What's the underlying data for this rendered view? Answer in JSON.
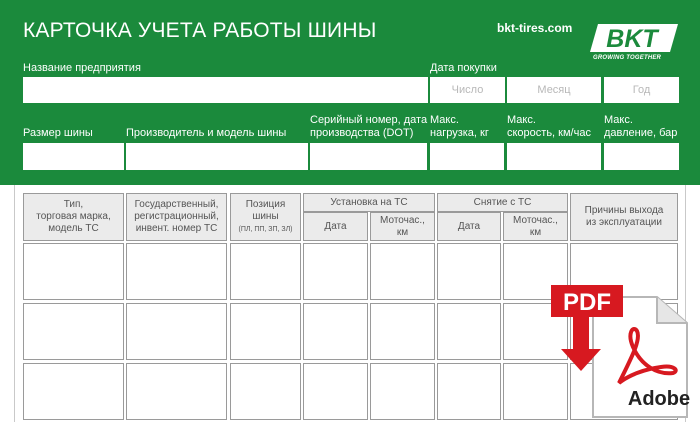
{
  "header": {
    "title": "КАРТОЧКА УЧЕТА РАБОТЫ ШИНЫ",
    "site": "bkt-tires.com",
    "logo_text": "BKT",
    "tagline": "GROWING TOGETHER",
    "bg_color": "#1b8a3c"
  },
  "form": {
    "company_label": "Название предприятия",
    "purchase_date_label": "Дата покупки",
    "day_placeholder": "Число",
    "month_placeholder": "Месяц",
    "year_placeholder": "Год",
    "size_label": "Размер шины",
    "maker_label": "Производитель и модель шины",
    "serial_label_1": "Серийный номер, дата",
    "serial_label_2": "производства (DOT)",
    "load_label_1": "Макс.",
    "load_label_2": "нагрузка, кг",
    "speed_label_1": "Макс.",
    "speed_label_2": "скорость, км/час",
    "pressure_label_1": "Макс.",
    "pressure_label_2": "давление, бар"
  },
  "table": {
    "col_type": [
      "Тип,",
      "торговая марка,",
      "модель ТС"
    ],
    "col_reg": [
      "Государственный,",
      "регистрационный,",
      "инвент. номер ТС"
    ],
    "col_pos": [
      "Позиция",
      "шины"
    ],
    "col_pos_hint": "(ПЛ, ПП, ЗП, ЗЛ)",
    "install_group": "Установка на ТС",
    "removal_group": "Снятие с ТС",
    "date_label": "Дата",
    "hours_label": [
      "Моточас.,",
      "км"
    ],
    "col_reason": [
      "Причины выхода",
      "из эксплуатации"
    ]
  },
  "pdf_badge": {
    "label": "PDF",
    "brand": "Adobe",
    "color": "#d71920"
  }
}
